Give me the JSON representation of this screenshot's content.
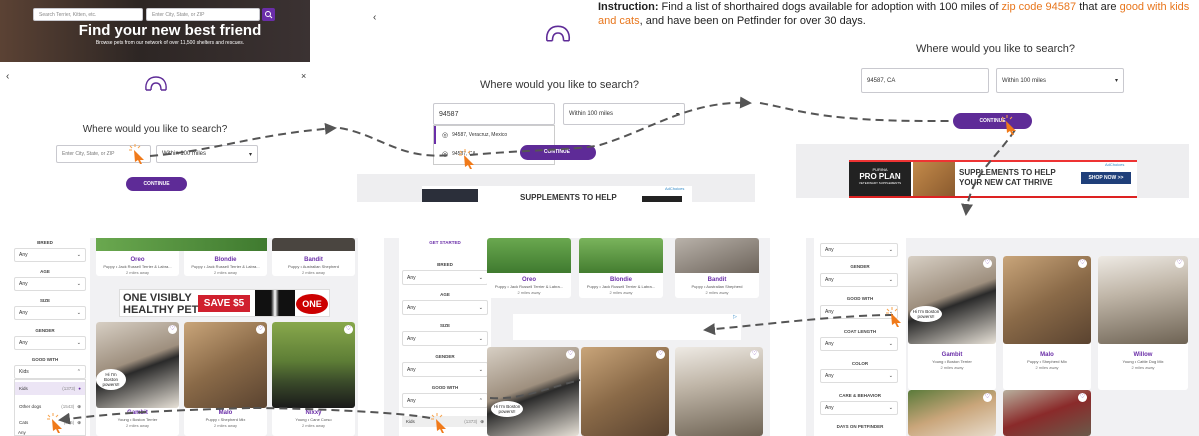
{
  "instruction": {
    "prefix": "Instruction:",
    "text_1": " Find a list of shorthaired dogs available for adoption with 100 miles of ",
    "zip_phrase": "zip code 94587",
    "text_2": " that are ",
    "good_phrase": "good with kids and cats",
    "text_3": ", and have been on Petfinder for over 30 days."
  },
  "hero": {
    "search_pet_placeholder": "Search Terrier, Kitten, etc.",
    "search_location_placeholder": "Enter City, State, or ZIP",
    "title": "Find your new best friend",
    "subtitle": "Browse pets from our network of over 11,500 shelters and rescues."
  },
  "step1": {
    "question": "Where would you like to search?",
    "location_placeholder": "Enter City, State, or ZIP",
    "distance": "Within 100 miles",
    "continue": "CONTINUE",
    "back": "‹",
    "close": "×"
  },
  "step2": {
    "question": "Where would you like to search?",
    "location_value": "94587",
    "distance": "Within 100 miles",
    "suggestions": [
      "94587, Veracruz, Mexico",
      "94587, CA"
    ],
    "continue": "CONTINUE",
    "back": "‹",
    "ad_text": "SUPPLEMENTS TO HELP",
    "ad_choices": "AdChoices"
  },
  "step3": {
    "question": "Where would you like to search?",
    "location_value": "94587, CA",
    "distance": "Within 100 miles",
    "continue": "CONTINUE",
    "ad_line1": "SUPPLEMENTS TO HELP",
    "ad_line2": "YOUR NEW CAT THRIVE",
    "ad_cta": "SHOP NOW >>",
    "ad_brand_top": "PURINA",
    "ad_brand": "PRO PLAN",
    "ad_brand_sub": "VETERINARY SUPPLEMENTS",
    "ad_choices": "AdChoices"
  },
  "results_left": {
    "filters": {
      "breed": "BREED",
      "breed_val": "Any",
      "age": "AGE",
      "age_val": "Any",
      "size": "SIZE",
      "size_val": "Any",
      "gender": "GENDER",
      "gender_val": "Any",
      "good_with": "GOOD WITH",
      "good_with_val": "Kids",
      "options": [
        {
          "label": "Kids",
          "count": "(1373)"
        },
        {
          "label": "Other dogs",
          "count": "(1543)"
        },
        {
          "label": "Cats",
          "count": "(626)"
        }
      ],
      "more": "Any"
    },
    "top_cards": [
      {
        "name": "Oreo",
        "meta": "Puppy • Jack Russell Terrier & Labra...",
        "dist": "2 miles away"
      },
      {
        "name": "Blondie",
        "meta": "Puppy • Jack Russell Terrier & Labra...",
        "dist": "2 miles away"
      },
      {
        "name": "Bandit",
        "meta": "Puppy • Australian Shepherd",
        "dist": "2 miles away"
      }
    ],
    "ad": {
      "line1": "ONE VISIBLY",
      "line2": "HEALTHY PET",
      "save": "SAVE $5",
      "brand": "ONE"
    },
    "bubble": "Hi I'm Boston powers!!",
    "cards": [
      {
        "name": "Gambit",
        "meta": "Young • Boston Terrier",
        "dist": "2 miles away"
      },
      {
        "name": "Malo",
        "meta": "Puppy • Shepherd Mix",
        "dist": "2 miles away"
      },
      {
        "name": "Nixxy",
        "meta": "Young • Cane Corso",
        "dist": "2 miles away"
      }
    ]
  },
  "results_mid": {
    "get_started": "GET STARTED",
    "filters": {
      "breed": "BREED",
      "breed_val": "Any",
      "age": "AGE",
      "age_val": "Any",
      "size": "SIZE",
      "size_val": "Any",
      "gender": "GENDER",
      "gender_val": "Any",
      "good_with": "GOOD WITH",
      "good_with_val": "Any",
      "kids": "Kids",
      "kids_count": "(1373)"
    },
    "top_cards": [
      {
        "name": "Oreo",
        "meta": "Puppy • Jack Russell Terrier & Labra...",
        "dist": "2 miles away"
      },
      {
        "name": "Blondie",
        "meta": "Puppy • Jack Russell Terrier & Labra...",
        "dist": "2 miles away"
      },
      {
        "name": "Bandit",
        "meta": "Puppy • Australian Shepherd",
        "dist": "2 miles away"
      }
    ],
    "bubble": "Hi I'm Boston powers!!"
  },
  "results_right": {
    "filters": {
      "any_top": "Any",
      "gender": "GENDER",
      "gender_val": "Any",
      "good_with": "GOOD WITH",
      "good_with_val": "Any",
      "coat": "COAT LENGTH",
      "coat_val": "Any",
      "color": "COLOR",
      "color_val": "Any",
      "care": "CARE & BEHAVIOR",
      "care_val": "Any",
      "days": "DAYS ON PETFINDER"
    },
    "bubble": "Hi I'm Boston powers!!",
    "cards": [
      {
        "name": "Gambit",
        "meta": "Young • Boston Terrier",
        "dist": "2 miles away"
      },
      {
        "name": "Malo",
        "meta": "Puppy • Shepherd Mix",
        "dist": "2 miles away"
      },
      {
        "name": "Willow",
        "meta": "Young • Cattle Dog Mix",
        "dist": "2 miles away"
      }
    ]
  },
  "colors": {
    "accent": "#5e2b97",
    "highlight": "#e8761c",
    "arrow": "#555555"
  }
}
